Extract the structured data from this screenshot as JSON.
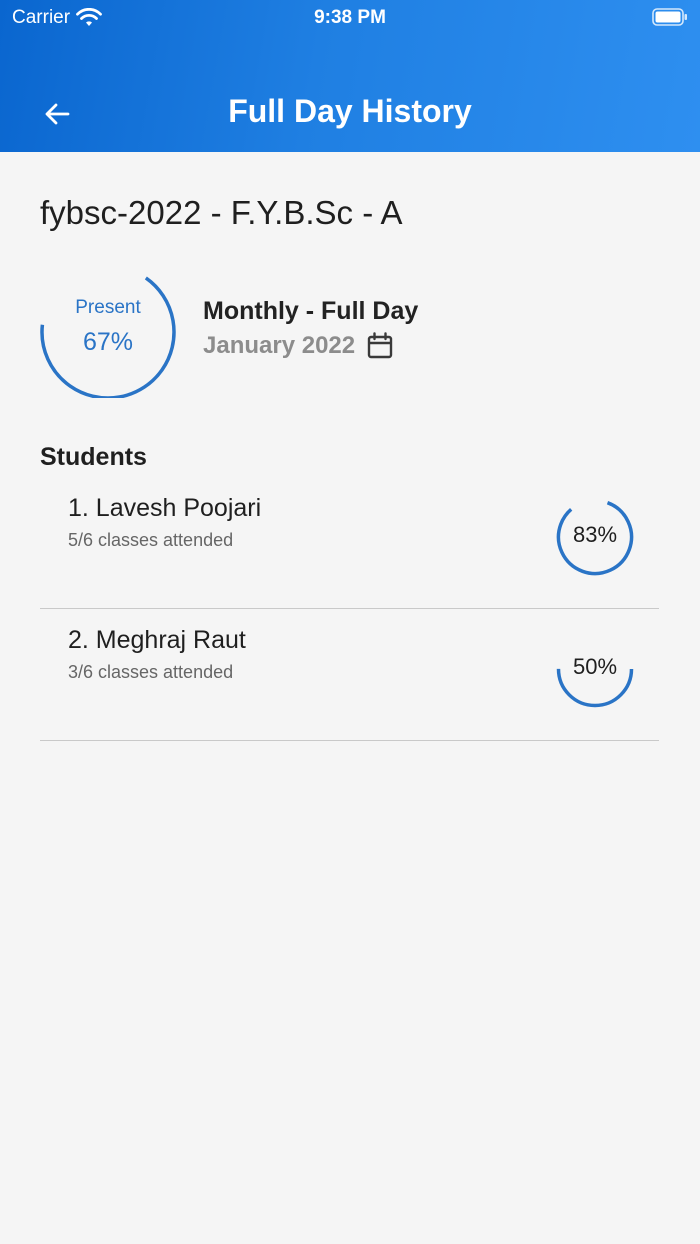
{
  "status_bar": {
    "carrier": "Carrier",
    "time": "9:38 PM"
  },
  "header": {
    "title": "Full Day History",
    "back_icon": "arrow-left-icon"
  },
  "class": {
    "name": "fybsc-2022 - F.Y.B.Sc - A"
  },
  "summary": {
    "label": "Present",
    "percent_text": "67%",
    "percent_value": 67,
    "period_type": "Monthly - Full Day",
    "period_month": "January 2022",
    "calendar_icon": "calendar-icon"
  },
  "students": {
    "heading": "Students",
    "items": [
      {
        "name": "1. Lavesh Poojari",
        "attended": "5/6 classes attended",
        "percent_text": "83%",
        "percent_value": 83
      },
      {
        "name": "2. Meghraj Raut",
        "attended": "3/6 classes attended",
        "percent_text": "50%",
        "percent_value": 50
      }
    ]
  },
  "colors": {
    "header_gradient_start": "#0a66cf",
    "header_gradient_end": "#2e8ff0",
    "accent": "#2a74c6",
    "background": "#f5f5f5",
    "divider": "#c9c9c9"
  }
}
